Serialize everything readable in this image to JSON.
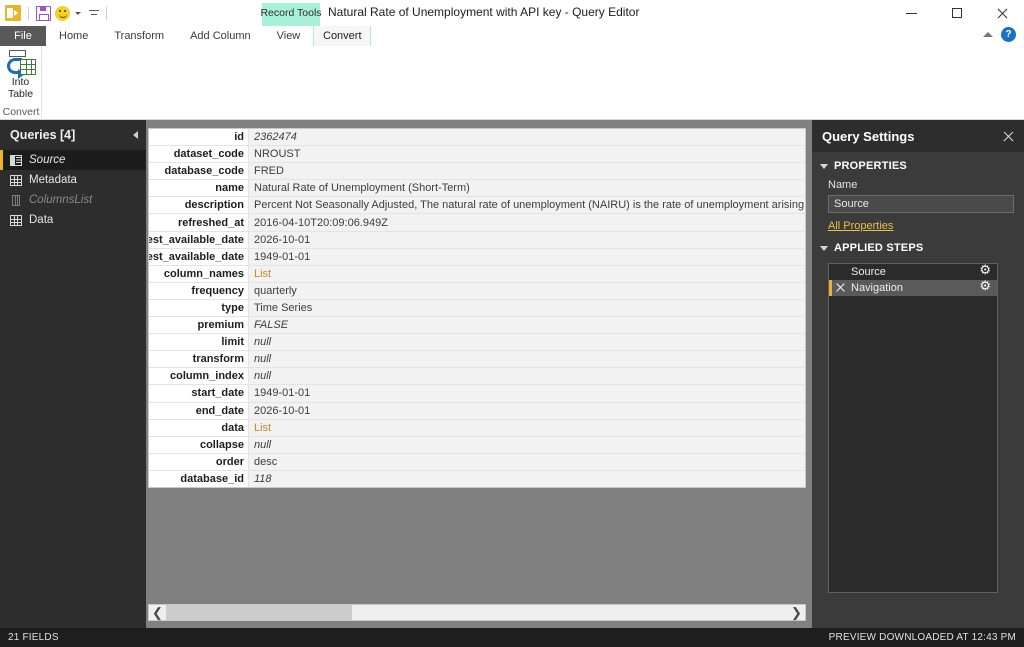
{
  "titlebar": {
    "window_title": "Natural Rate of Unemployment with API key - Query Editor",
    "contextual_tab": "Record Tools",
    "quick_access": {
      "app_icon": "powerbi-icon",
      "save_icon": "save-icon",
      "smiley_icon": "smiley-icon",
      "customize_icon": "customize-toolbar-icon"
    },
    "minimize": "minimize-icon",
    "maximize": "maximize-icon",
    "close": "close-icon"
  },
  "ribbon": {
    "tabs": [
      {
        "label": "File"
      },
      {
        "label": "Home"
      },
      {
        "label": "Transform"
      },
      {
        "label": "Add Column"
      },
      {
        "label": "View"
      }
    ],
    "contextual_tab_label": "Convert",
    "collapse_icon": "chevron-up-icon",
    "help_label": "?",
    "group": {
      "name": "Convert",
      "button_label_line1": "Into",
      "button_label_line2": "Table",
      "button_icon": "into-table-icon"
    }
  },
  "queries": {
    "title": "Queries [4]",
    "collapse_icon": "chevron-left-icon",
    "items": [
      {
        "label": "Source",
        "icon": "record-icon",
        "selected": true,
        "dim": false,
        "italic": true
      },
      {
        "label": "Metadata",
        "icon": "table-icon",
        "selected": false,
        "dim": false,
        "italic": false
      },
      {
        "label": "ColumnsList",
        "icon": "list-icon",
        "selected": false,
        "dim": true,
        "italic": true
      },
      {
        "label": "Data",
        "icon": "table-icon",
        "selected": false,
        "dim": false,
        "italic": false
      }
    ]
  },
  "record_grid": {
    "rows": [
      {
        "key": "id",
        "value": "2362474",
        "style": "italic"
      },
      {
        "key": "dataset_code",
        "value": "NROUST",
        "style": "plain"
      },
      {
        "key": "database_code",
        "value": "FRED",
        "style": "plain"
      },
      {
        "key": "name",
        "value": "Natural Rate of Unemployment (Short-Term)",
        "style": "plain"
      },
      {
        "key": "description",
        "value": "Percent Not Seasonally Adjusted, The natural rate of unemployment (NAIRU) is the rate of unemployment arising from all sources except fluc",
        "style": "plain"
      },
      {
        "key": "refreshed_at",
        "value": "2016-04-10T20:09:06.949Z",
        "style": "plain"
      },
      {
        "key": "newest_available_date",
        "value": "2026-10-01",
        "style": "plain"
      },
      {
        "key": "oldest_available_date",
        "value": "1949-01-01",
        "style": "plain"
      },
      {
        "key": "column_names",
        "value": "List",
        "style": "link"
      },
      {
        "key": "frequency",
        "value": "quarterly",
        "style": "plain"
      },
      {
        "key": "type",
        "value": "Time Series",
        "style": "plain"
      },
      {
        "key": "premium",
        "value": "FALSE",
        "style": "italic"
      },
      {
        "key": "limit",
        "value": "null",
        "style": "italic"
      },
      {
        "key": "transform",
        "value": "null",
        "style": "italic"
      },
      {
        "key": "column_index",
        "value": "null",
        "style": "italic"
      },
      {
        "key": "start_date",
        "value": "1949-01-01",
        "style": "plain"
      },
      {
        "key": "end_date",
        "value": "2026-10-01",
        "style": "plain"
      },
      {
        "key": "data",
        "value": "List",
        "style": "link"
      },
      {
        "key": "collapse",
        "value": "null",
        "style": "italic"
      },
      {
        "key": "order",
        "value": "desc",
        "style": "plain"
      },
      {
        "key": "database_id",
        "value": "118",
        "style": "italic"
      }
    ],
    "scroll_left_icon": "chevron-left-icon",
    "scroll_right_icon": "chevron-right-icon"
  },
  "query_settings": {
    "title": "Query Settings",
    "close_icon": "close-icon",
    "properties_section": "PROPERTIES",
    "name_label": "Name",
    "name_value": "Source",
    "all_properties_link": "All Properties",
    "applied_steps_section": "APPLIED STEPS",
    "steps": [
      {
        "label": "Source",
        "active": false,
        "has_delete": false,
        "gear_icon": "gear-icon"
      },
      {
        "label": "Navigation",
        "active": true,
        "has_delete": true,
        "gear_icon": "gear-icon"
      }
    ]
  },
  "statusbar": {
    "left": "21 FIELDS",
    "right": "PREVIEW DOWNLOADED AT 12:43 PM"
  },
  "colors": {
    "accent_yellow": "#e8b62c",
    "contextual_tab": "#a8f0d8",
    "link_orange": "#c38a2a",
    "panel_dark": "#2d2d2d"
  }
}
